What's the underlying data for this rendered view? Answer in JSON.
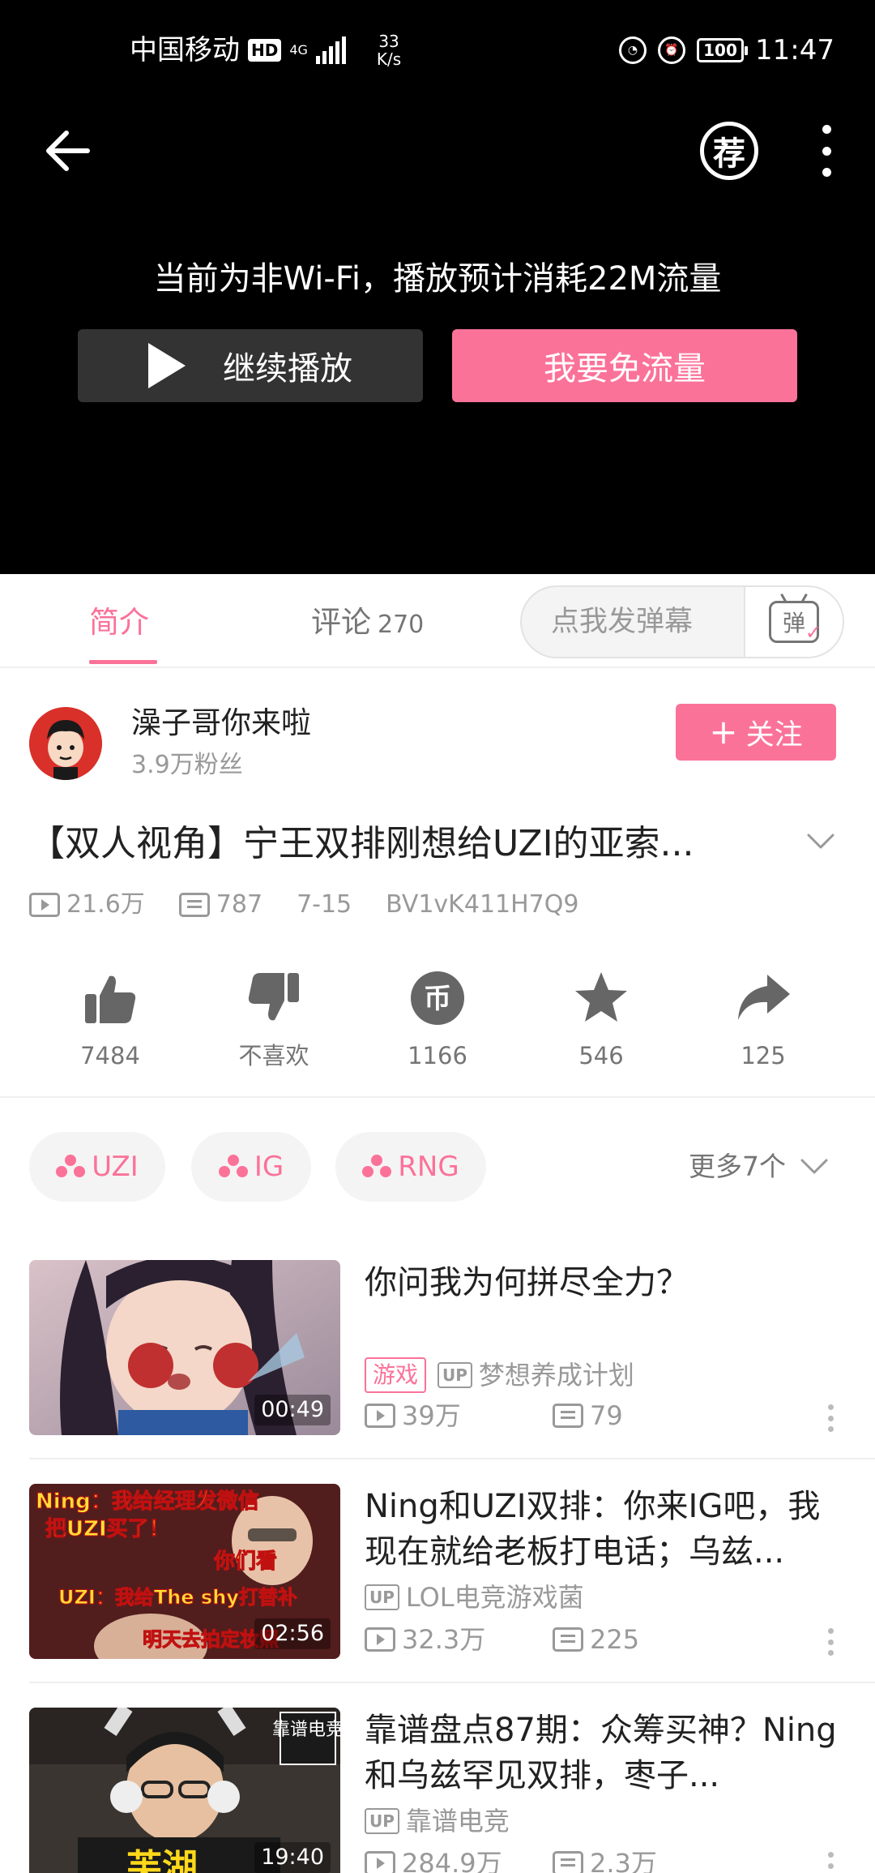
{
  "status_bar": {
    "carrier": "中国移动",
    "hd": "HD",
    "network": "4G",
    "speed_value": "33",
    "speed_unit": "K/s",
    "battery": "100",
    "time": "11:47"
  },
  "player": {
    "recommend_icon_char": "荐",
    "data_warning": "当前为非Wi-Fi，播放预计消耗22M流量",
    "continue_label": "继续播放",
    "free_data_label": "我要免流量"
  },
  "tabs": {
    "intro": "简介",
    "comments": "评论",
    "comments_count": "270",
    "danmaku_placeholder": "点我发弹幕",
    "danmaku_icon_char": "弹"
  },
  "uploader": {
    "name": "澡子哥你来啦",
    "fans": "3.9万粉丝",
    "follow_label": "关注"
  },
  "video": {
    "title": "【双人视角】宁王双排刚想给UZI的亚索...",
    "views": "21.6万",
    "danmaku": "787",
    "date": "7-15",
    "bvid": "BV1vK411H7Q9"
  },
  "actions": [
    {
      "name": "like",
      "label": "7484"
    },
    {
      "name": "dislike",
      "label": "不喜欢"
    },
    {
      "name": "coin",
      "label": "1166"
    },
    {
      "name": "favorite",
      "label": "546"
    },
    {
      "name": "share",
      "label": "125"
    }
  ],
  "coin_char": "币",
  "tags": [
    "UZI",
    "IG",
    "RNG"
  ],
  "more_tags": "更多7个",
  "related": [
    {
      "title": "你问我为何拼尽全力？",
      "duration": "00:49",
      "badge": "游戏",
      "up_badge": "UP",
      "uploader": "梦想养成计划",
      "views": "39万",
      "danmaku": "79"
    },
    {
      "title": "Ning和UZI双排：你来IG吧，我现在就给老板打电话；乌兹...",
      "duration": "02:56",
      "up_badge": "UP",
      "uploader": "LOL电竞游戏菌",
      "views": "32.3万",
      "danmaku": "225",
      "thumb_lines": [
        "Ning：我给经理发微信",
        "把UZI买了！",
        "你们看",
        "UZI：我给The shy打替补",
        "明天去拍定妆照"
      ]
    },
    {
      "title": "靠谱盘点87期：众筹买神？Ning和乌兹罕见双排，枣子...",
      "duration": "19:40",
      "up_badge": "UP",
      "uploader": "靠谱电竞",
      "views": "284.9万",
      "danmaku": "2.3万",
      "thumb_logo": "靠谱电竞",
      "thumb_overlay": "芙湖"
    }
  ],
  "colors": {
    "accent": "#fb7299",
    "player_bg": "#000000",
    "muted": "#999999"
  }
}
